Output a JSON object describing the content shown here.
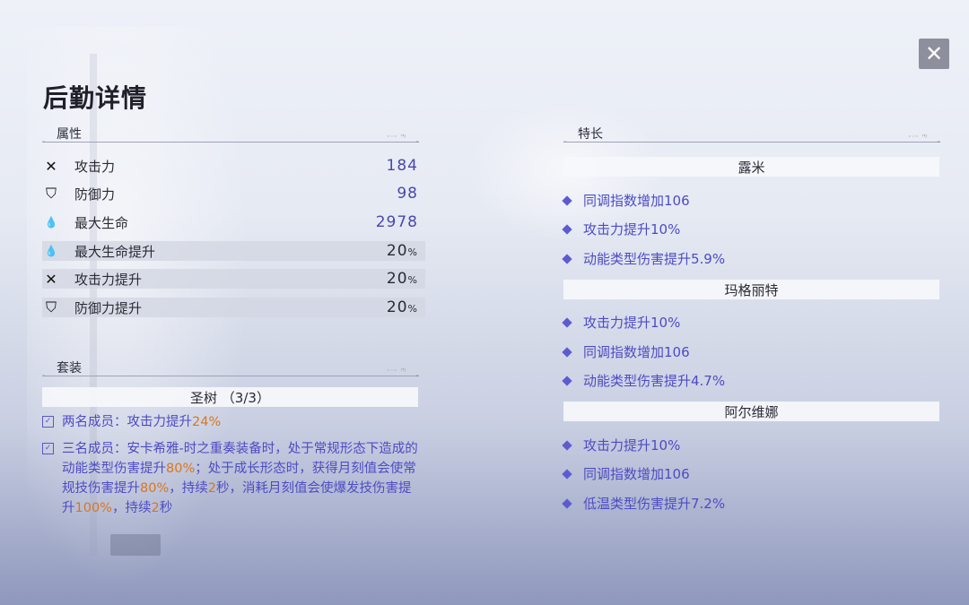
{
  "title": "后勤详情",
  "close_label": "✕",
  "attributes": {
    "header": "属性",
    "rows": [
      {
        "icon": "✕",
        "icon_name": "attack-icon",
        "name": "攻击力",
        "value": "184"
      },
      {
        "icon": "⛉",
        "icon_name": "defense-icon",
        "name": "防御力",
        "value": "98"
      },
      {
        "icon": "💧",
        "icon_name": "hp-drop-icon",
        "name": "最大生命",
        "value": "2978"
      },
      {
        "icon": "💧",
        "icon_name": "hp-drop-icon",
        "name": "最大生命提升",
        "value": "20",
        "unit": "%"
      },
      {
        "icon": "✕",
        "icon_name": "attack-icon",
        "name": "攻击力提升",
        "value": "20",
        "unit": "%"
      },
      {
        "icon": "⛉",
        "icon_name": "defense-icon",
        "name": "防御力提升",
        "value": "20",
        "unit": "%"
      }
    ]
  },
  "set": {
    "header": "套装",
    "name": "圣树 （3/3）",
    "two_piece": {
      "prefix": "两名成员：攻击力提升",
      "v1": "24%"
    },
    "three_piece": {
      "t1": "三名成员：安卡希雅-时之重奏装备时，处于常规形态下造成的动能类型伤害提升",
      "v1": "80%",
      "t2": "；处于成长形态时，获得月刻值会使常规技伤害提升",
      "v2": "80%",
      "t3": "，持续",
      "v3": "2",
      "t4": "秒，消耗月刻值会使爆发技伤害提升",
      "v4": "100%",
      "t5": "，持续",
      "v5": "2",
      "t6": "秒"
    }
  },
  "specialties": {
    "header": "特长",
    "groups": [
      {
        "name": "露米",
        "perks": [
          "同调指数增加106",
          "攻击力提升10%",
          "动能类型伤害提升5.9%"
        ]
      },
      {
        "name": "玛格丽特",
        "perks": [
          "攻击力提升10%",
          "同调指数增加106",
          "动能类型伤害提升4.7%"
        ]
      },
      {
        "name": "阿尔维娜",
        "perks": [
          "攻击力提升10%",
          "同调指数增加106",
          "低温类型伤害提升7.2%"
        ]
      }
    ]
  },
  "colors": {
    "accent": "#4e4bc4",
    "highlight": "#d9761e",
    "value": "#4b47b0"
  }
}
